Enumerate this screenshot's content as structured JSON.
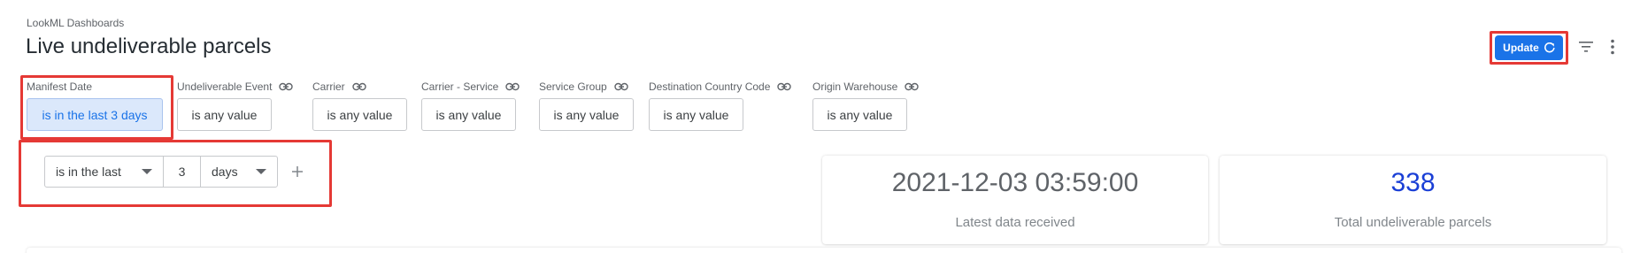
{
  "header": {
    "breadcrumb": "LookML Dashboards",
    "title": "Live undeliverable parcels"
  },
  "toolbar": {
    "update_label": "Update",
    "accent_color": "#1a73e8",
    "highlight_color": "#e53935"
  },
  "filters": [
    {
      "label": "Manifest Date",
      "value": "is in the last 3 days",
      "linked": false,
      "active": true
    },
    {
      "label": "Undeliverable Event",
      "value": "is any value",
      "linked": true
    },
    {
      "label": "Carrier",
      "value": "is any value",
      "linked": true
    },
    {
      "label": "Carrier - Service",
      "value": "is any value",
      "linked": true
    },
    {
      "label": "Service Group",
      "value": "is any value",
      "linked": true
    },
    {
      "label": "Destination Country Code",
      "value": "is any value",
      "linked": true
    },
    {
      "label": "Origin Warehouse",
      "value": "is any value",
      "linked": true
    }
  ],
  "expression": {
    "operator": "is in the last",
    "number": "3",
    "unit": "days"
  },
  "tiles": [
    {
      "value": "2021-12-03 03:59:00",
      "label": "Latest data received",
      "value_color": "#5f6368"
    },
    {
      "value": "338",
      "label": "Total undeliverable parcels",
      "value_color": "#1a3fd6"
    }
  ]
}
